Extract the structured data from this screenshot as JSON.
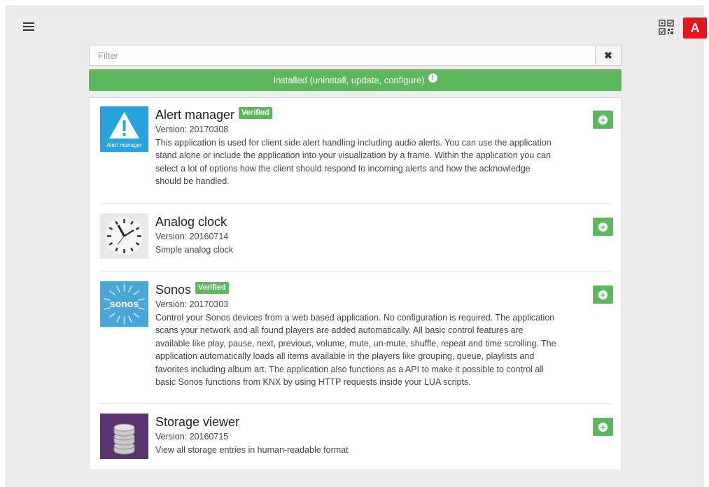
{
  "toolbar": {
    "menu_icon": "hamburger-menu-icon",
    "qr_icon": "qr-code-icon",
    "user_badge": "A"
  },
  "filter": {
    "placeholder": "Filter",
    "value": "",
    "clear_icon": "close-icon"
  },
  "installed_bar": {
    "label": "Installed (uninstall, update, configure)",
    "info_icon": "!"
  },
  "apps": [
    {
      "name": "Alert manager",
      "verified": "Verified",
      "version": "Version: 20170308",
      "description": "This application is used for client side alert handling including audio alerts. You can use the application stand alone or include the application into your visualization by a frame. Within the application you can select a lot of options how the client should respond to incoming alerts and how the acknowledge should be handled.",
      "thumb_label": "Alert manager",
      "add_icon": "plus-circle-icon"
    },
    {
      "name": "Analog clock",
      "verified": "",
      "version": "Version: 20160714",
      "description": "Simple analog clock",
      "add_icon": "plus-circle-icon"
    },
    {
      "name": "Sonos",
      "verified": "Verified",
      "version": "Version: 20170303",
      "description": "Control your Sonos devices from a web based application. No configuration is required. The application scans your network and all found players are added automatically. All basic control features are available like play, pause, next, previous, volume, mute, un-mute, shuffle, repeat and time scrolling. The application automatically loads all items available in the players like grouping, queue, playlists and favorites including album art. The application also functions as a API to make it possible to control all basic Sonos functions from KNX by using HTTP requests inside your LUA scripts.",
      "thumb_label": "sonos",
      "add_icon": "plus-circle-icon"
    },
    {
      "name": "Storage viewer",
      "verified": "",
      "version": "Version: 20160715",
      "description": "View all storage entries in human-readable format",
      "add_icon": "plus-circle-icon"
    }
  ],
  "colors": {
    "accent_green": "#5cb85c",
    "badge_red": "#e8141b",
    "alert_blue": "#29a3dc",
    "sonos_blue": "#4aa5d9",
    "storage_purple": "#5a3470"
  }
}
